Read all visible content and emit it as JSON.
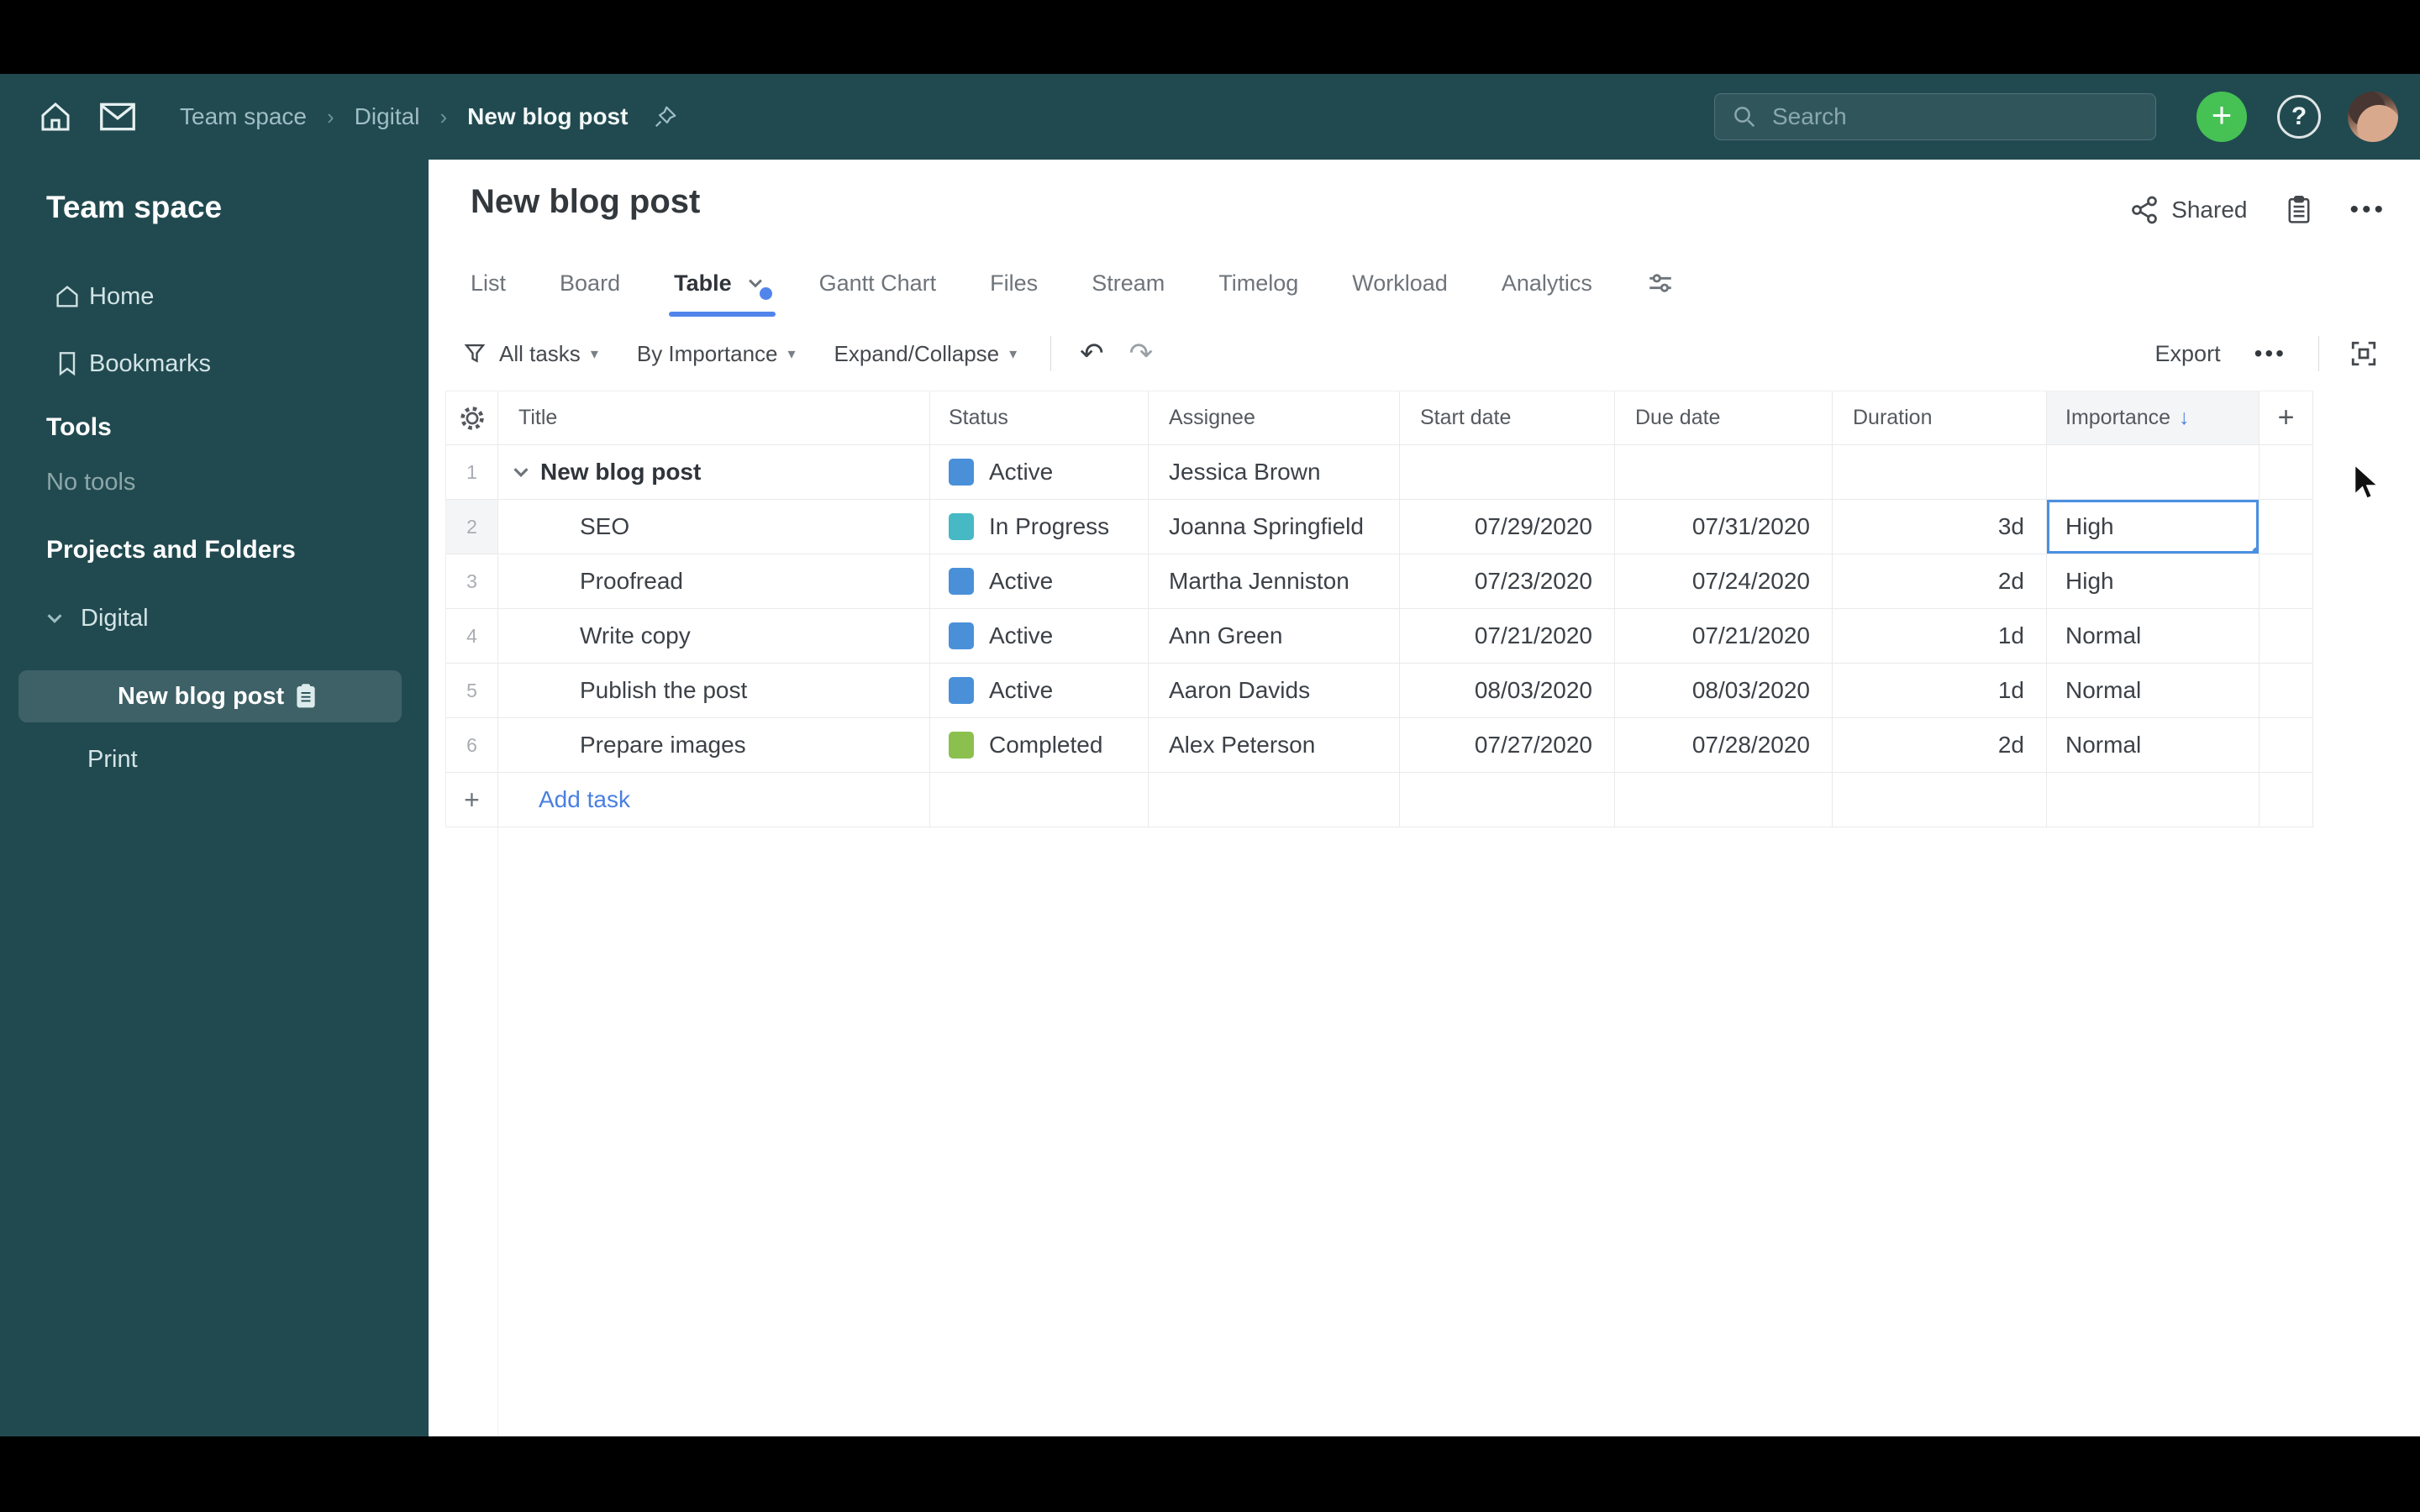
{
  "topbar": {
    "breadcrumb": [
      "Team space",
      "Digital",
      "New blog post"
    ],
    "search_placeholder": "Search",
    "plus_label": "+",
    "help_label": "?"
  },
  "sidebar": {
    "title": "Team space",
    "nav": [
      {
        "label": "Home"
      },
      {
        "label": "Bookmarks"
      }
    ],
    "tools_heading": "Tools",
    "no_tools_label": "No tools",
    "projects_heading": "Projects and Folders",
    "folder_label": "Digital",
    "selected_project_label": "New blog post",
    "print_label": "Print"
  },
  "header": {
    "title": "New blog post",
    "shared_label": "Shared",
    "more_label": "•••"
  },
  "tabs": [
    {
      "label": "List",
      "active": false
    },
    {
      "label": "Board",
      "active": false
    },
    {
      "label": "Table",
      "active": true
    },
    {
      "label": "Gantt Chart",
      "active": false
    },
    {
      "label": "Files",
      "active": false
    },
    {
      "label": "Stream",
      "active": false
    },
    {
      "label": "Timelog",
      "active": false
    },
    {
      "label": "Workload",
      "active": false
    },
    {
      "label": "Analytics",
      "active": false
    }
  ],
  "toolbar": {
    "filter_label": "All tasks",
    "sort_label": "By Importance",
    "expand_label": "Expand/Collapse",
    "export_label": "Export",
    "more_label": "•••"
  },
  "table": {
    "columns": [
      "Title",
      "Status",
      "Assignee",
      "Start date",
      "Due date",
      "Duration",
      "Importance"
    ],
    "sorted_column": "Importance",
    "sort_direction": "desc",
    "rows": [
      {
        "num": "1",
        "title": "New blog post",
        "parent": true,
        "selected": false,
        "status": "Active",
        "status_color": "#4a90d9",
        "assignee": "Jessica Brown",
        "start": "",
        "due": "",
        "duration": "",
        "importance": ""
      },
      {
        "num": "2",
        "title": "SEO",
        "parent": false,
        "selected": true,
        "status": "In Progress",
        "status_color": "#46b9c5",
        "assignee": "Joanna Springfield",
        "start": "07/29/2020",
        "due": "07/31/2020",
        "duration": "3d",
        "importance": "High"
      },
      {
        "num": "3",
        "title": "Proofread",
        "parent": false,
        "selected": false,
        "status": "Active",
        "status_color": "#4a90d9",
        "assignee": "Martha Jenniston",
        "start": "07/23/2020",
        "due": "07/24/2020",
        "duration": "2d",
        "importance": "High"
      },
      {
        "num": "4",
        "title": "Write copy",
        "parent": false,
        "selected": false,
        "status": "Active",
        "status_color": "#4a90d9",
        "assignee": "Ann Green",
        "start": "07/21/2020",
        "due": "07/21/2020",
        "duration": "1d",
        "importance": "Normal"
      },
      {
        "num": "5",
        "title": "Publish the post",
        "parent": false,
        "selected": false,
        "status": "Active",
        "status_color": "#4a90d9",
        "assignee": "Aaron Davids",
        "start": "08/03/2020",
        "due": "08/03/2020",
        "duration": "1d",
        "importance": "Normal"
      },
      {
        "num": "6",
        "title": "Prepare images",
        "parent": false,
        "selected": false,
        "status": "Completed",
        "status_color": "#8cc04e",
        "assignee": "Alex Peterson",
        "start": "07/27/2020",
        "due": "07/28/2020",
        "duration": "2d",
        "importance": "Normal"
      }
    ],
    "add_task_label": "Add task"
  },
  "colors": {
    "chrome_teal": "#214a50",
    "accent_blue": "#5285ec",
    "selection_blue": "#4a90e2",
    "add_button_green": "#45c253",
    "status_active": "#4a90d9",
    "status_in_progress": "#46b9c5",
    "status_completed": "#8cc04e",
    "link_blue": "#4a7fe0"
  }
}
